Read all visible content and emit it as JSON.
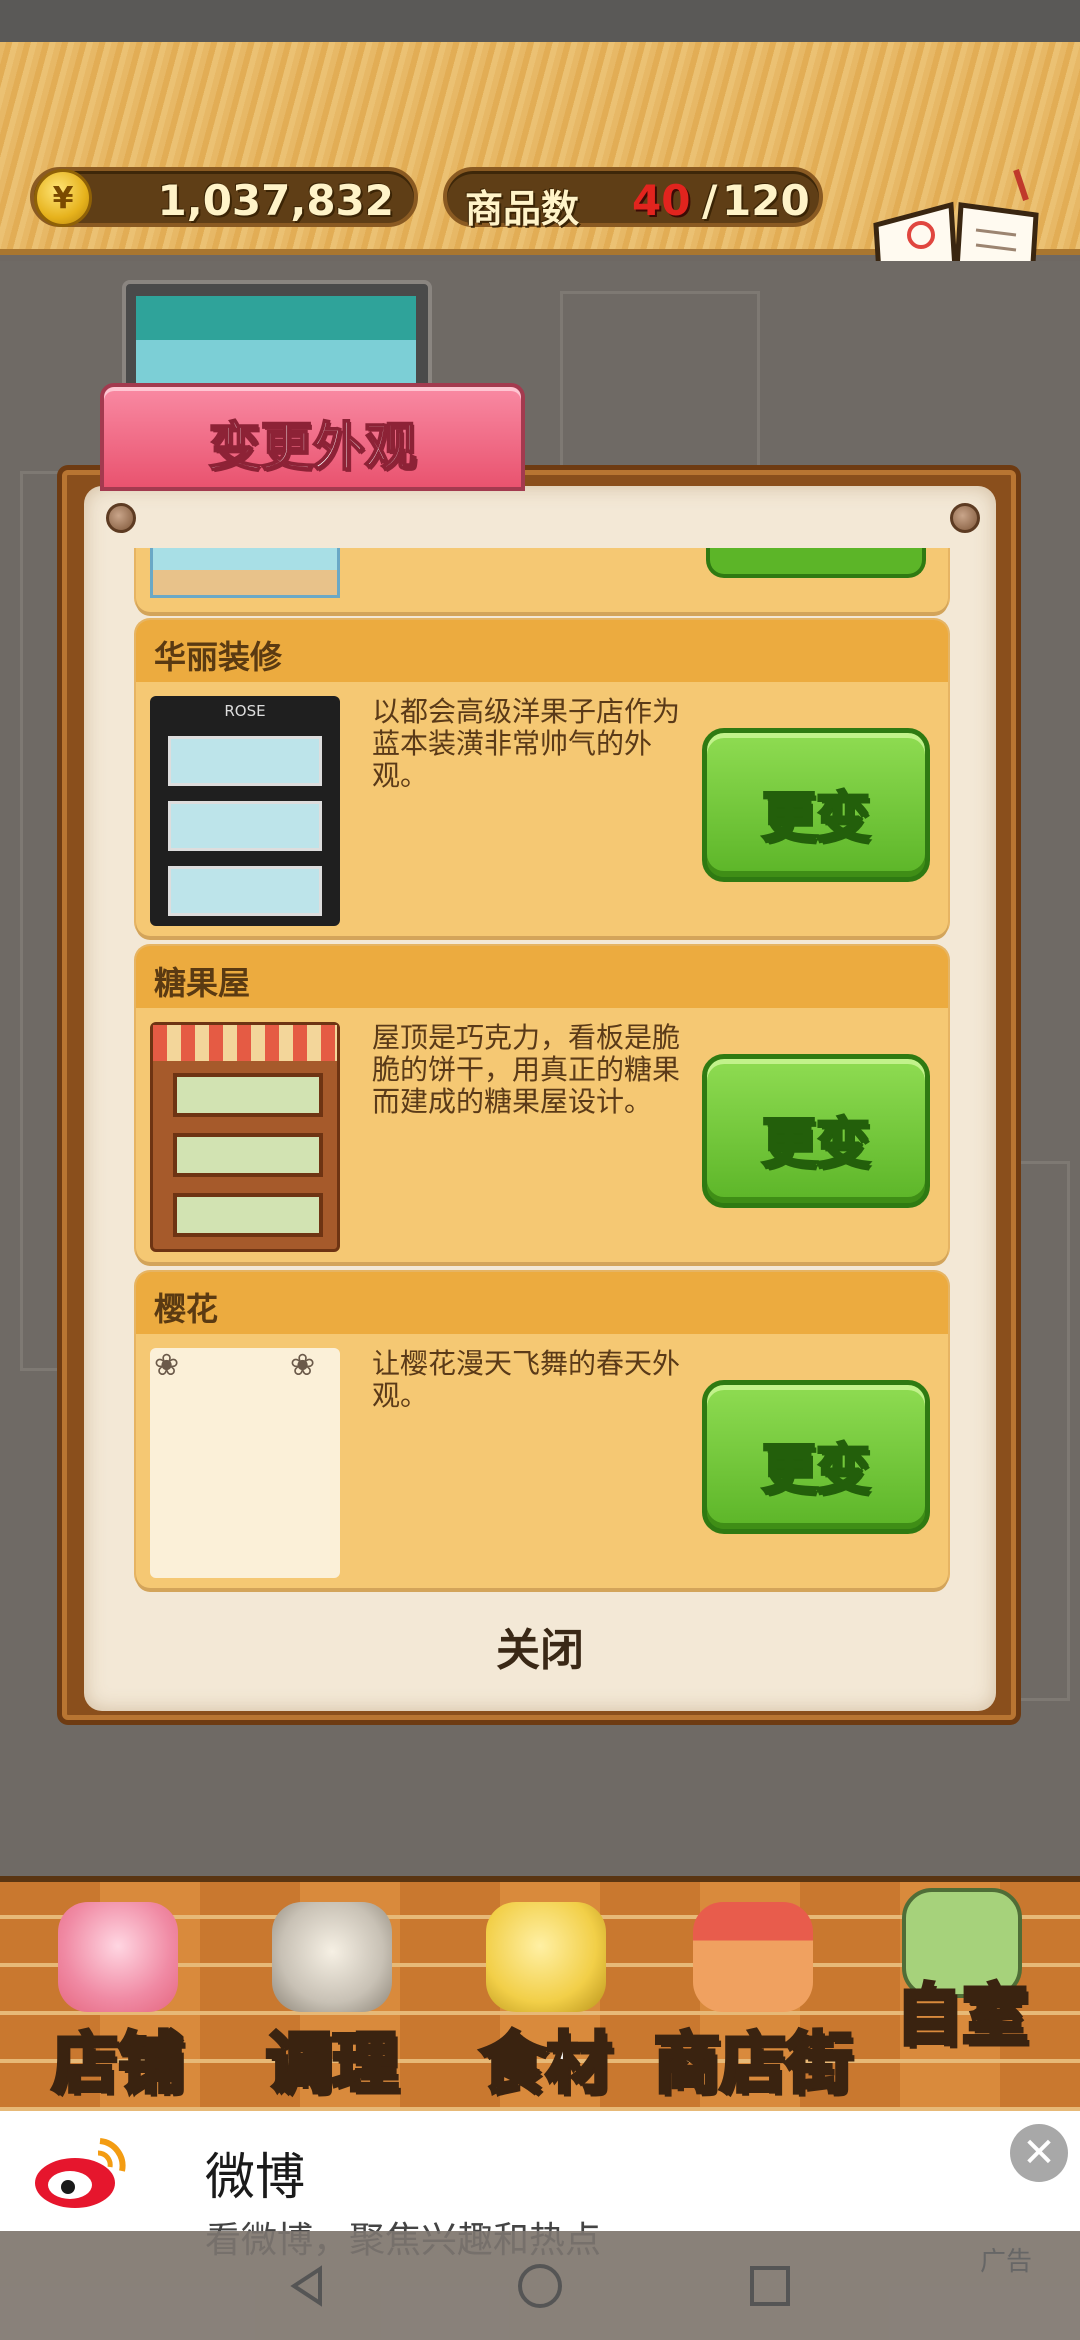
{
  "header": {
    "money_value": "1,037,832",
    "currency_symbol": "¥",
    "count_label": "商品数",
    "count_current": "40",
    "count_separator": "/",
    "count_total": "120",
    "recipe_label": "食谱"
  },
  "modal": {
    "title": "变更外观",
    "close_label": "关闭",
    "items": [
      {
        "name": "华丽装修",
        "description": "以都会高级洋果子店作为蓝本装潢非常帅气的外观。",
        "button": "更变",
        "thumb_sign": "ROSE"
      },
      {
        "name": "糖果屋",
        "description": "屋顶是巧克力，看板是脆脆的饼干，用真正的糖果而建成的糖果屋设计。",
        "button": "更变"
      },
      {
        "name": "樱花",
        "description": "让樱花漫天飞舞的春天外观。",
        "button": "更变"
      }
    ]
  },
  "bottom_nav": [
    {
      "label": "店铺",
      "icon": "cake-icon"
    },
    {
      "label": "调理",
      "icon": "mixing-bowl-icon"
    },
    {
      "label": "食材",
      "icon": "flour-sack-icon"
    },
    {
      "label": "商店街",
      "icon": "shop-street-icon"
    },
    {
      "label": "自室",
      "icon": "staff-room-icon"
    }
  ],
  "ad": {
    "title": "微博",
    "subtitle": "看微博，聚焦兴趣和热点",
    "tag": "广告",
    "close_symbol": "✕"
  },
  "colors": {
    "accent_green": "#5cb528",
    "tab_pink": "#e9536f",
    "card_yellow": "#f5c873",
    "card_header": "#ecab3f"
  }
}
